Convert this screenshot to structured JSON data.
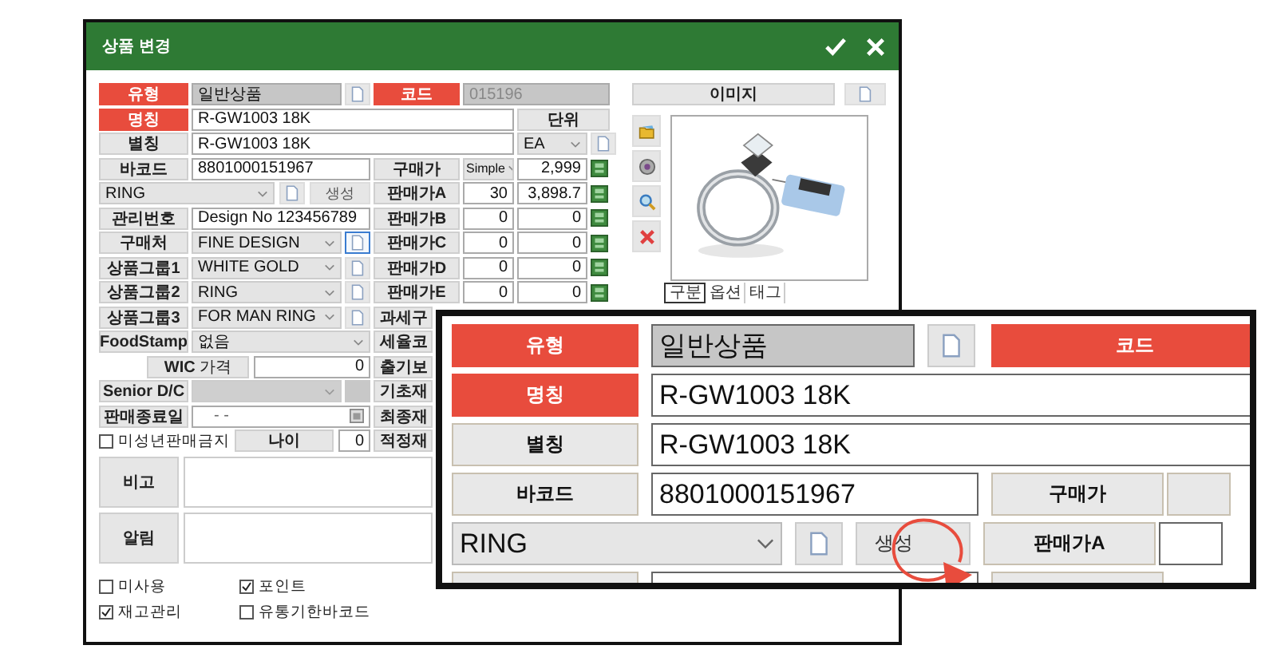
{
  "window": {
    "title": "상품 변경"
  },
  "type": {
    "label": "유형",
    "value": "일반상품",
    "required": true
  },
  "code": {
    "label": "코드",
    "value": "015196",
    "required": true
  },
  "name": {
    "label": "명칭",
    "value": "R-GW1003 18K",
    "required": true
  },
  "unit": {
    "label": "단위",
    "value": "EA"
  },
  "alias": {
    "label": "별칭",
    "value": "R-GW1003 18K",
    "required": false
  },
  "barcode": {
    "label": "바코드",
    "value": "8801000151967",
    "required": false
  },
  "category": {
    "value": "RING",
    "generate": "생성"
  },
  "management": {
    "label": "관리번호",
    "value": "Design No 123456789",
    "required": false
  },
  "selects": [
    {
      "label": "구매처",
      "value": "FINE DESIGN",
      "selected": true
    },
    {
      "label": "상품그룹1",
      "value": "WHITE GOLD",
      "selected": false
    },
    {
      "label": "상품그룹2",
      "value": "RING",
      "selected": false
    },
    {
      "label": "상품그룹3",
      "value": "FOR MAN RING",
      "selected": false
    }
  ],
  "food_stamp": {
    "label": "FoodStamp",
    "value": "없음"
  },
  "wic": {
    "label": "**WIC** 가격",
    "value": "0"
  },
  "senior": {
    "label": "Senior D/C",
    "disabled": true
  },
  "end_date": {
    "label": "판매종료일",
    "value": "-  -"
  },
  "minor": {
    "label": "미성년판매금지",
    "checked": false
  },
  "age": {
    "label": "나이",
    "value": "0"
  },
  "notes": [
    {
      "label": "비고"
    },
    {
      "label": "알림"
    }
  ],
  "options": [
    {
      "label": "미사용",
      "checked": false
    },
    {
      "label": "포인트",
      "checked": true
    },
    {
      "label": "재고관리",
      "checked": true
    },
    {
      "label": "유통기한바코드",
      "checked": false
    }
  ],
  "prices": [
    {
      "kind": "select",
      "label": "구매가",
      "option": "Simple",
      "value": "2,999"
    },
    {
      "kind": "rate",
      "label": "판매가A",
      "rate": "30",
      "value": "3,898.7"
    },
    {
      "kind": "rate",
      "label": "판매가B",
      "rate": "0",
      "value": "0"
    },
    {
      "kind": "rate",
      "label": "판매가C",
      "rate": "0",
      "value": "0"
    },
    {
      "kind": "rate",
      "label": "판매가D",
      "rate": "0",
      "value": "0"
    },
    {
      "kind": "rate",
      "label": "판매가E",
      "rate": "0",
      "value": "0"
    }
  ],
  "cut_labels": [
    "과세구",
    "세율코",
    "출기보",
    "기초재",
    "최종재",
    "적정재"
  ],
  "image": {
    "label": "이미지",
    "kind": "picture",
    "tabs": [
      {
        "label": "구분",
        "selected": true
      },
      {
        "label": "옵션",
        "selected": false
      },
      {
        "label": "태그",
        "selected": false
      }
    ]
  },
  "inset": {
    "type": {
      "label": "유형",
      "value": "일반상품",
      "required": true
    },
    "code": {
      "label": "코드",
      "required": true
    },
    "name": {
      "label": "명칭",
      "value": "R-GW1003 18K",
      "required": true
    },
    "alias": {
      "label": "별칭",
      "value": "R-GW1003 18K",
      "required": false
    },
    "barcode": {
      "label": "바코드",
      "value": "8801000151967",
      "required": false
    },
    "purchase": {
      "label": "구매가"
    },
    "category": {
      "value": "RING",
      "generate": "생성"
    },
    "sale": {
      "label": "판매가A"
    }
  }
}
